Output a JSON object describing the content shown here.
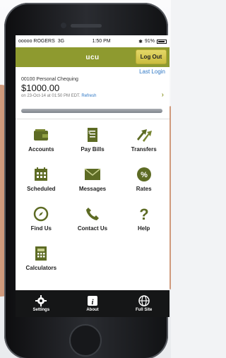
{
  "status": {
    "carrier": "ooooo ROGERS",
    "network": "3G",
    "time": "1:50 PM",
    "bluetooth": "✱",
    "battery": "91%"
  },
  "header": {
    "title": "ucu",
    "logout_label": "Log Out"
  },
  "account": {
    "last_login": "Last Login",
    "name": "00100 Personal Chequing",
    "balance": "$1000.00",
    "as_of": "on 23-Oct-14 at 01:50 PM EDT.",
    "refresh": "Refresh"
  },
  "menu": {
    "items": [
      {
        "label": "Accounts",
        "icon": "wallet-icon"
      },
      {
        "label": "Pay Bills",
        "icon": "bill-icon"
      },
      {
        "label": "Transfers",
        "icon": "transfer-arrows-icon"
      },
      {
        "label": "Scheduled",
        "icon": "calendar-icon"
      },
      {
        "label": "Messages",
        "icon": "envelope-icon"
      },
      {
        "label": "Rates",
        "icon": "percent-icon"
      },
      {
        "label": "Find Us",
        "icon": "compass-icon"
      },
      {
        "label": "Contact Us",
        "icon": "phone-icon"
      },
      {
        "label": "Help",
        "icon": "question-icon"
      },
      {
        "label": "Calculators",
        "icon": "calculator-icon"
      }
    ]
  },
  "tabbar": {
    "settings": "Settings",
    "about": "About",
    "full_site": "Full Site"
  },
  "colors": {
    "brand": "#8e9a2f",
    "logout": "#d9cb52",
    "link": "#2f78c5",
    "icon": "#5d6b24"
  }
}
